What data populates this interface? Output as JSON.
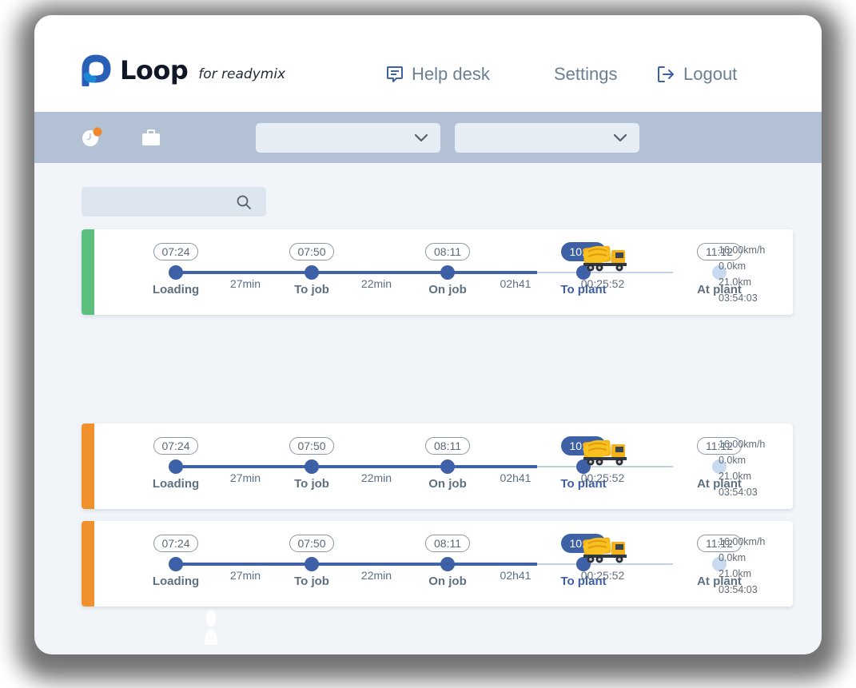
{
  "brand": {
    "name": "Loop",
    "tagline": "for readymix"
  },
  "nav": {
    "help": "Help desk",
    "settings": "Settings",
    "logout": "Logout"
  },
  "toolbar": {
    "dropdown1_value": "",
    "dropdown2_value": ""
  },
  "search": {
    "placeholder": ""
  },
  "colors": {
    "status_green": "#5dbf7e",
    "status_orange": "#f0912d",
    "track_blue": "#3d60a6",
    "notification_dot": "#f0872d"
  },
  "trips": [
    {
      "status": "green",
      "stages": [
        {
          "time": "07:24",
          "label": "Loading"
        },
        {
          "time": "07:50",
          "label": "To job"
        },
        {
          "time": "08:11",
          "label": "On job"
        },
        {
          "time": "10:52",
          "label": "To plant",
          "current": true
        },
        {
          "time": "11:12",
          "label": "At plant",
          "future": true
        }
      ],
      "durations": [
        "27min",
        "22min",
        "02h41"
      ],
      "elapsed": "00:25:52",
      "stats": [
        "16.00km/h",
        "0.0km",
        "21.0km",
        "03:54:03"
      ]
    },
    {
      "status": "orange",
      "stages": [
        {
          "time": "07:24",
          "label": "Loading"
        },
        {
          "time": "07:50",
          "label": "To job"
        },
        {
          "time": "08:11",
          "label": "On job"
        },
        {
          "time": "10:52",
          "label": "To plant",
          "current": true
        },
        {
          "time": "11:12",
          "label": "At plant",
          "future": true
        }
      ],
      "durations": [
        "27min",
        "22min",
        "02h41"
      ],
      "elapsed": "00:25:52",
      "stats": [
        "16.00km/h",
        "0.0km",
        "21.0km",
        "03:54:03"
      ]
    },
    {
      "status": "orange",
      "stages": [
        {
          "time": "07:24",
          "label": "Loading"
        },
        {
          "time": "07:50",
          "label": "To job"
        },
        {
          "time": "08:11",
          "label": "On job"
        },
        {
          "time": "10:52",
          "label": "To plant",
          "current": true
        },
        {
          "time": "11:12",
          "label": "At plant",
          "future": true
        }
      ],
      "durations": [
        "27min",
        "22min",
        "02h41"
      ],
      "elapsed": "00:25:52",
      "stats": [
        "16.00km/h",
        "0.0km",
        "21.0km",
        "03:54:03"
      ]
    }
  ],
  "icons": {
    "logo": "loop-logo-icon",
    "help": "chat-icon",
    "logout": "logout-icon",
    "history": "clock-icon",
    "orders": "briefcase-icon",
    "dropdown": "chevron-down-icon",
    "search": "search-icon",
    "truck": "mixer-truck-icon"
  }
}
